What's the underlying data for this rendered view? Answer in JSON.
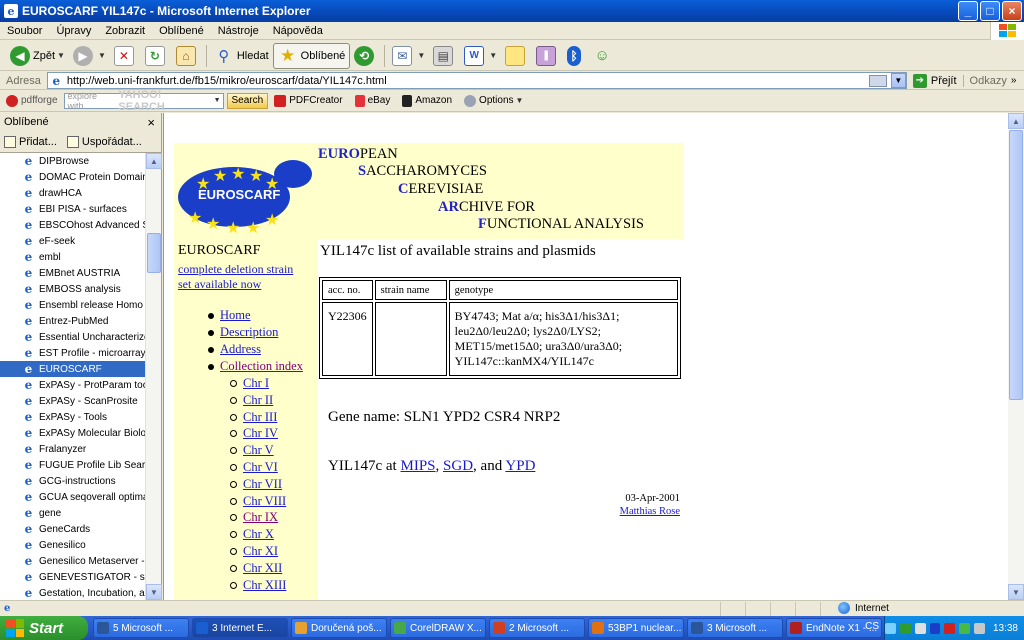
{
  "window": {
    "title": "EUROSCARF YIL147c - Microsoft Internet Explorer",
    "minimize": "_",
    "maximize": "□",
    "close": "×"
  },
  "menu": [
    "Soubor",
    "Úpravy",
    "Zobrazit",
    "Oblíbené",
    "Nástroje",
    "Nápověda"
  ],
  "toolbar": {
    "back": "Zpět",
    "search": "Hledat",
    "favorites": "Oblíbené"
  },
  "address": {
    "label": "Adresa",
    "url": "http://web.uni-frankfurt.de/fb15/mikro/euroscarf/data/YIL147c.html",
    "go": "Přejít",
    "links": "Odkazy"
  },
  "yahoo": {
    "pdfforge": "pdfforge",
    "placeholder": "explore with",
    "brand": "YAHOO! SEARCH",
    "search": "Search",
    "pdfcreator": "PDFCreator",
    "ebay": "eBay",
    "amazon": "Amazon",
    "options": "Options"
  },
  "favorites": {
    "title": "Oblíbené",
    "close": "×",
    "add": "Přidat...",
    "organize": "Uspořádat...",
    "items": [
      "DIPBrowse",
      "DOMAC Protein Domain P...",
      "drawHCA",
      "EBI PISA - surfaces",
      "EBSCOhost Advanced Se...",
      "eF-seek",
      "embl",
      "EMBnet AUSTRIA",
      "EMBOSS analysis",
      "Ensembl release Homo sa...",
      "Entrez-PubMed",
      "Essential Uncharacterized...",
      "EST Profile - microarray",
      "EUROSCARF",
      "ExPASy - ProtParam tool",
      "ExPASy - ScanProsite",
      "ExPASy - Tools",
      "ExPASy Molecular Biology...",
      "Fralanyzer",
      "FUGUE Profile Lib Search",
      "GCG-instructions",
      "GCUA seqoverall optimal",
      "gene",
      "GeneCards",
      "Genesilico",
      "Genesilico Metaserver - m...",
      "GENEVESTIGATOR - shap...",
      "Gestation, Incubation, an..."
    ],
    "selected_index": 13
  },
  "page": {
    "logo_text": "EUROSCARF",
    "banner": [
      {
        "cap": "EURO",
        "rest": "PEAN"
      },
      {
        "cap": "S",
        "rest": "ACCHAROMYCES"
      },
      {
        "cap": "C",
        "rest": "EREVISIAE"
      },
      {
        "cap": "AR",
        "rest": "CHIVE FOR"
      },
      {
        "cap": "F",
        "rest": "UNCTIONAL ANALYSIS"
      }
    ],
    "side_title": "EUROSCARF",
    "side_link_1": "complete deletion strain",
    "side_link_2": "set available now",
    "nav": [
      "Home",
      "Description",
      "Address",
      "Collection index"
    ],
    "chromosomes": [
      "Chr I",
      "Chr II",
      "Chr III",
      "Chr IV",
      "Chr V",
      "Chr VI",
      "Chr VII",
      "Chr VIII",
      "Chr IX",
      "Chr X",
      "Chr XI",
      "Chr XII",
      "Chr XIII"
    ],
    "heading": "YIL147c list of available strains and plasmids",
    "table": {
      "headers": [
        "acc. no.",
        "strain name",
        "genotype"
      ],
      "row": {
        "acc": "Y22306",
        "strain": "",
        "genotype_lines": [
          "BY4743; Mat a/α; his3Δ1/his3Δ1;",
          "leu2Δ0/leu2Δ0; lys2Δ0/LYS2;",
          "MET15/met15Δ0; ura3Δ0/ura3Δ0;",
          "YIL147c::kanMX4/YIL147c"
        ]
      }
    },
    "gene_name": "Gene name: SLN1 YPD2 CSR4 NRP2",
    "at_prefix": "YIL147c at ",
    "links": [
      "MIPS",
      "SGD",
      "YPD"
    ],
    "comma": ", ",
    "and": ", and ",
    "date": "03-Apr-2001",
    "author": "Matthias Rose"
  },
  "status": {
    "zone": "Internet"
  },
  "taskbar": {
    "start": "Start",
    "tasks": [
      "5 Microsoft ...",
      "3 Internet E...",
      "Doručená poš...",
      "CorelDRAW X...",
      "2 Microsoft ...",
      "53BP1 nuclear...",
      "3 Microsoft ...",
      "EndNote X1 - ..."
    ],
    "active_index": 1,
    "lang": "CS",
    "time": "13:38"
  },
  "colors": {
    "selected": "#316ac5",
    "link": "#1a1acc",
    "visited": "#800080",
    "page_bg": "#ffffcc"
  }
}
